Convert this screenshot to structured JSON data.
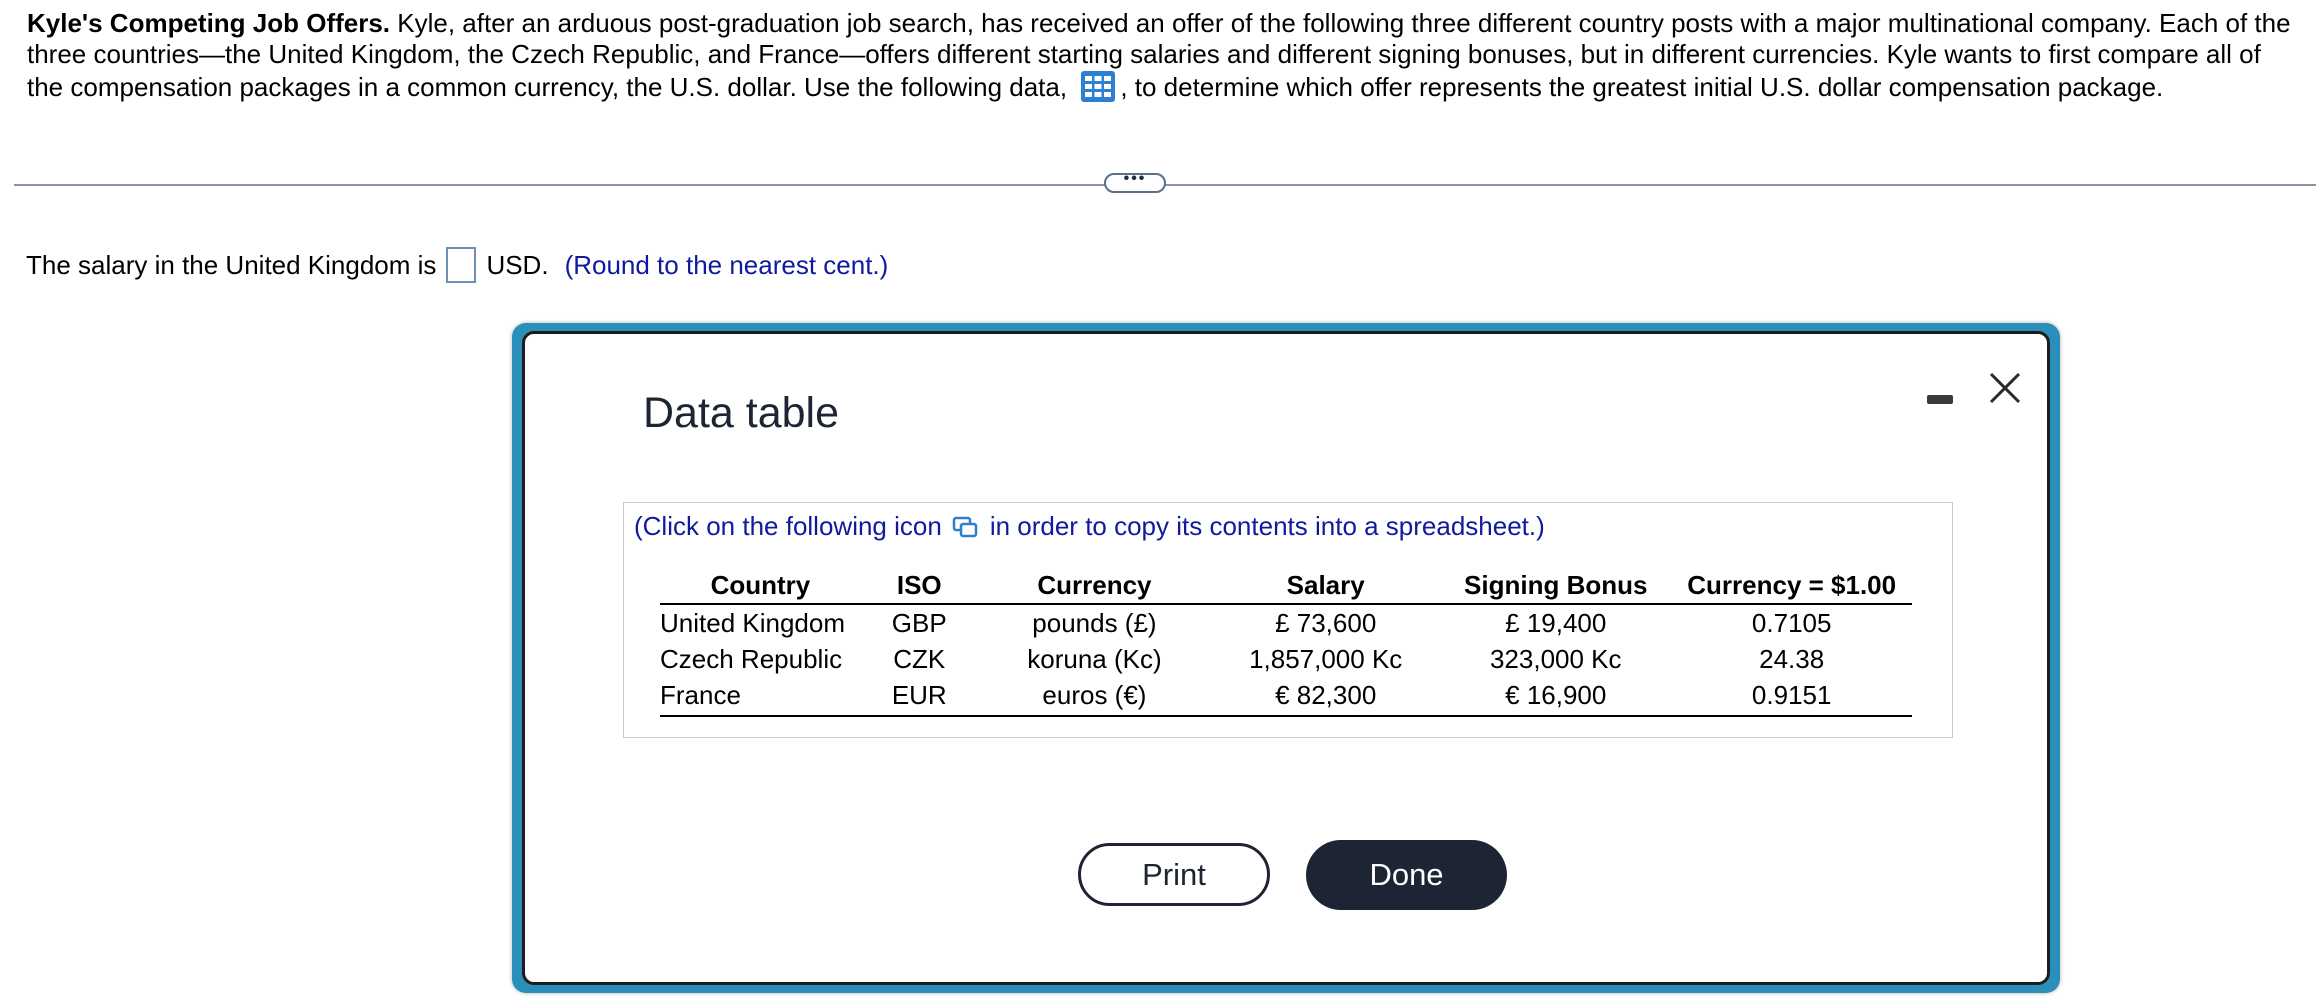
{
  "problem": {
    "title": "Kyle's Competing Job Offers.",
    "text_before_icon": " Kyle, after an arduous post-graduation job search, has received an offer of the following three different country posts with a major multinational company. Each of the three countries—the United Kingdom, the Czech Republic, and France—offers different starting salaries and different signing bonuses, but in different currencies. Kyle wants to first compare all of the compensation packages in a common currency, the U.S. dollar. Use the following data,",
    "text_after_icon": ", to determine which offer represents the greatest initial U.S. dollar compensation package."
  },
  "divider": {
    "dots": "•••"
  },
  "question": {
    "prefix": "The salary in the United Kingdom is",
    "answer_value": "",
    "suffix": "USD.",
    "hint": "(Round to the nearest cent.)"
  },
  "dialog": {
    "title": "Data table",
    "copy_note_before": "(Click on the following icon",
    "copy_note_after": "in order to copy its contents into a spreadsheet.)",
    "headers": [
      "Country",
      "ISO",
      "Currency",
      "Salary",
      "Signing Bonus",
      "Currency = $1.00"
    ],
    "rows": [
      [
        "United Kingdom",
        "GBP",
        "pounds (£)",
        "£ 73,600",
        "£ 19,400",
        "0.7105"
      ],
      [
        "Czech Republic",
        "CZK",
        "koruna (Kc)",
        "1,857,000 Kc",
        "323,000 Kc",
        "24.38"
      ],
      [
        "France",
        "EUR",
        "euros (€)",
        "€ 82,300",
        "€ 16,900",
        "0.9151"
      ]
    ],
    "print_label": "Print",
    "done_label": "Done"
  },
  "colors": {
    "accent_blue": "#101a9e",
    "dialog_border": "#2b8fbb",
    "done_button": "#1d2433",
    "icon_blue": "#2d7fd3"
  },
  "icons": [
    "table-icon",
    "copy-icon",
    "minimize-icon",
    "close-icon"
  ]
}
